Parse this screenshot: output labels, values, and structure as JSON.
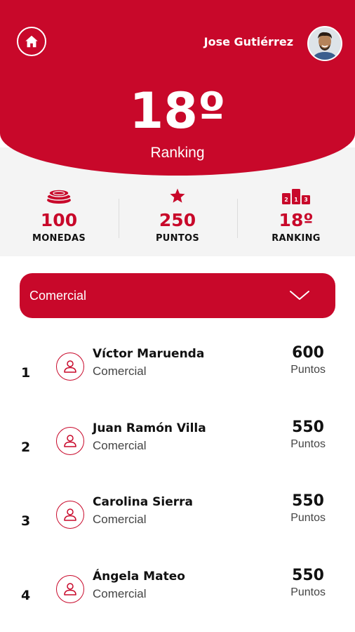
{
  "header": {
    "user_name": "Jose Gutiérrez",
    "rank_value": "18º",
    "rank_label": "Ranking"
  },
  "stats": [
    {
      "value": "100",
      "label": "MONEDAS",
      "icon": "coins-icon"
    },
    {
      "value": "250",
      "label": "PUNTOS",
      "icon": "star-icon"
    },
    {
      "value": "18º",
      "label": "RANKING",
      "icon": "podium-icon"
    }
  ],
  "dropdown": {
    "selected": "Comercial"
  },
  "ranking": [
    {
      "position": "1",
      "name": "Víctor Maruenda",
      "role": "Comercial",
      "points": "600",
      "points_label": "Puntos"
    },
    {
      "position": "2",
      "name": "Juan Ramón Villa",
      "role": "Comercial",
      "points": "550",
      "points_label": "Puntos"
    },
    {
      "position": "3",
      "name": "Carolina Sierra",
      "role": "Comercial",
      "points": "550",
      "points_label": "Puntos"
    },
    {
      "position": "4",
      "name": "Ángela Mateo",
      "role": "Comercial",
      "points": "550",
      "points_label": "Puntos"
    }
  ],
  "colors": {
    "brand_red": "#c8082a",
    "band_grey": "#f4f4f4"
  }
}
